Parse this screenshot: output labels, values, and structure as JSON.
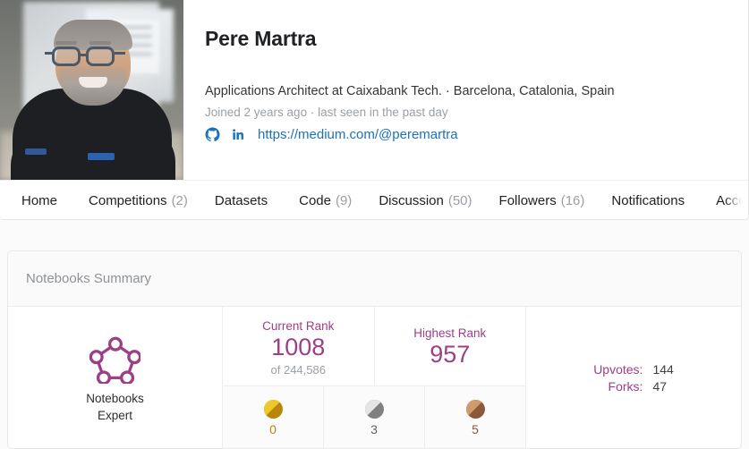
{
  "profile": {
    "name": "Pere Martra",
    "headline": "Applications Architect at Caixabank Tech. · Barcelona, Catalonia, Spain",
    "joined": "Joined 2 years ago · last seen in the past day",
    "url": "https://medium.com/@peremartra",
    "link_color": "#1a73b7",
    "social": [
      {
        "name": "github-icon",
        "label": "GitHub"
      },
      {
        "name": "linkedin-icon",
        "label": "LinkedIn"
      }
    ],
    "avatar_alt": "Profile photo of Pere Martra"
  },
  "nav": {
    "items": [
      {
        "label": "Home",
        "count": ""
      },
      {
        "label": "Competitions",
        "count": "(2)"
      },
      {
        "label": "Datasets",
        "count": ""
      },
      {
        "label": "Code",
        "count": "(9)"
      },
      {
        "label": "Discussion",
        "count": "(50)"
      },
      {
        "label": "Followers",
        "count": "(16)"
      },
      {
        "label": "Notifications",
        "count": ""
      },
      {
        "label": "Accoun",
        "count": ""
      }
    ]
  },
  "summary": {
    "title": "Notebooks Summary",
    "tier": {
      "badge_color": "#9c3f86",
      "line1": "Notebooks",
      "line2": "Expert"
    },
    "ranks": [
      {
        "caption": "Current Rank",
        "value": "1008",
        "sub": "of 244,586"
      },
      {
        "caption": "Highest Rank",
        "value": "957",
        "sub": ""
      }
    ],
    "medals": [
      {
        "type": "gold",
        "count": "0"
      },
      {
        "type": "silver",
        "count": "3"
      },
      {
        "type": "bronze",
        "count": "5"
      }
    ],
    "stats": [
      {
        "label": "Upvotes:",
        "value": "144"
      },
      {
        "label": "Forks:",
        "value": "47"
      }
    ],
    "accent_color": "#9c3f86"
  }
}
